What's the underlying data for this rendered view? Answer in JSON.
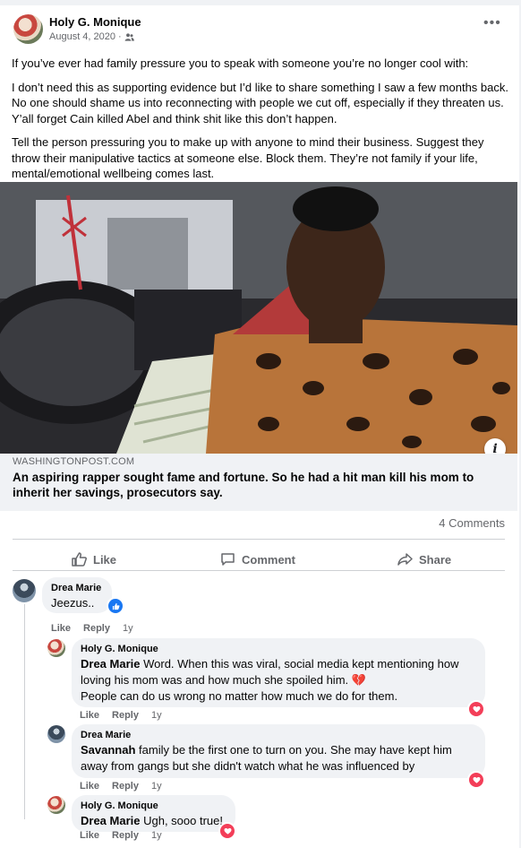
{
  "post": {
    "author": "Holy G. Monique",
    "date": "August 4, 2020",
    "paragraphs": [
      "If you’ve ever had family pressure you to speak with someone you’re no longer cool with:",
      "I don’t need this as supporting evidence but I’d like to share something I saw a few months back. No one should shame us into reconnecting with people we cut off, especially if they threaten us. Y’all forget Cain killed Abel and think shit like this don’t happen.",
      "Tell the person pressuring you to make up with anyone to mind their business. Suggest they throw their manipulative tactics at someone else. Block them. They’re not family if your life, mental/emotional wellbeing comes last."
    ]
  },
  "link": {
    "domain": "WASHINGTONPOST.COM",
    "title": "An aspiring rapper sought fame and fortune. So he had a hit man kill his mom to inherit her savings, prosecutors say."
  },
  "stats": {
    "comments": "4 Comments"
  },
  "actions": {
    "like": "Like",
    "comment": "Comment",
    "share": "Share"
  },
  "comments": [
    {
      "author": "Drea Marie",
      "mention": "",
      "text": "Jeezus..",
      "time": "1y"
    },
    {
      "author": "Holy G. Monique",
      "mention": "Drea Marie",
      "text": "Word. When this was viral, social media kept mentioning how loving his mom was and how much she spoiled him. 💔",
      "text2": "People can do us wrong no matter how much we do for them.",
      "time": "1y"
    },
    {
      "author": "Drea Marie",
      "mention": "Savannah",
      "text": "family be the first one to turn on you. She may have kept him away from gangs but she didn't watch what he was influenced by",
      "time": "1y"
    },
    {
      "author": "Holy G. Monique",
      "mention": "Drea Marie",
      "text": "Ugh, sooo true!",
      "time": "1y"
    }
  ],
  "labels": {
    "like": "Like",
    "reply": "Reply"
  }
}
